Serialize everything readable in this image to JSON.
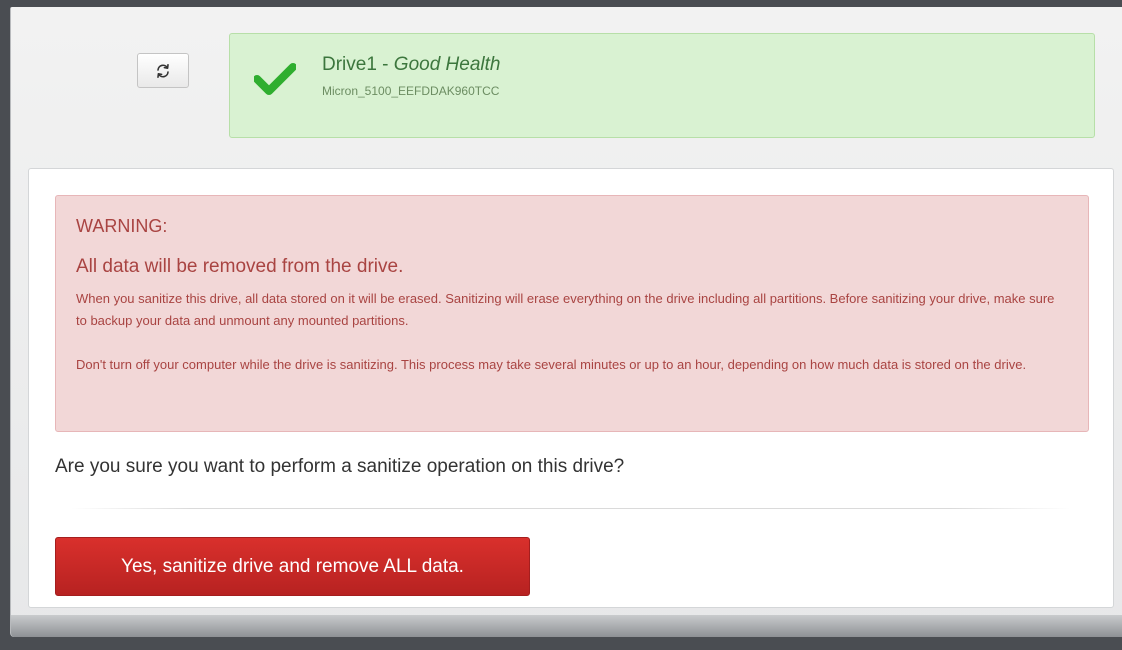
{
  "icons": {
    "refresh": "refresh-icon",
    "check": "checkmark-icon"
  },
  "drive": {
    "name": "Drive1",
    "separator": " - ",
    "health": "Good Health",
    "model": "Micron_5100_EEFDDAK960TCC"
  },
  "warning": {
    "heading": "WARNING:",
    "subheading": "All data will be removed from the drive.",
    "paragraph1": "When you sanitize this drive, all data stored on it will be erased. Sanitizing will erase everything on the drive including all partitions. Before sanitizing your drive, make sure to backup your data and unmount any mounted partitions.",
    "paragraph2": "Don't turn off your computer while the drive is sanitizing. This process may take several minutes or up to an hour, depending on how much data is stored on the drive."
  },
  "confirm": {
    "question": "Are you sure you want to perform a sanitize operation on this drive?",
    "button_label": "Yes, sanitize drive and remove ALL data."
  },
  "colors": {
    "success_bg": "#d9f2d2",
    "success_text": "#3c763d",
    "danger_bg": "#f2d7d7",
    "danger_text": "#a94442",
    "danger_button": "#c9302c"
  }
}
